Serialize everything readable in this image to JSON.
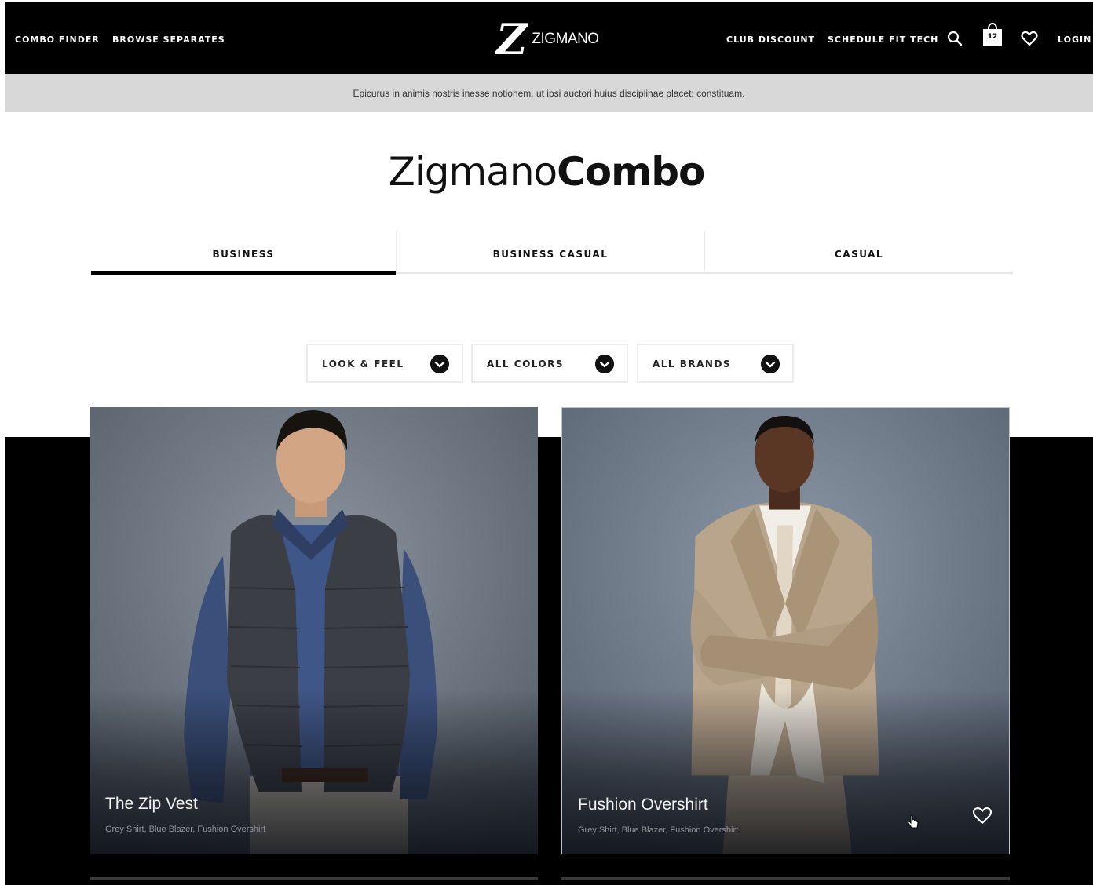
{
  "header": {
    "nav_left": [
      "COMBO FINDER",
      "BROWSE SEPARATES"
    ],
    "logo_mark": "Z",
    "logo_text": "ZIGMANO",
    "nav_right": [
      "CLUB DISCOUNT",
      "SCHEDULE FIT TECH"
    ],
    "bag_count": "12",
    "login": "LOGIN",
    "icons": [
      "search-icon",
      "shopping-bag-icon",
      "heart-icon"
    ]
  },
  "announcement": "Epicurus in animis nostris inesse notionem, ut ipsi auctori huius disciplinae placet: constituam.",
  "title": {
    "light": "Zigmano",
    "bold": "Combo"
  },
  "tabs": [
    {
      "label": "BUSINESS",
      "active": true
    },
    {
      "label": "BUSINESS CASUAL",
      "active": false
    },
    {
      "label": "CASUAL",
      "active": false
    }
  ],
  "filters": [
    {
      "label": "LOOK & FEEL"
    },
    {
      "label": "ALL COLORS"
    },
    {
      "label": "ALL BRANDS"
    }
  ],
  "products": [
    {
      "name": "The Zip Vest",
      "description": "Grey Shirt, Blue Blazer, Fushion Overshirt"
    },
    {
      "name": "Fushion Overshirt",
      "description": "Grey Shirt, Blue Blazer, Fushion Overshirt"
    }
  ],
  "colors": {
    "header_bg": "#000000",
    "announcement_bg": "#d8d8d8",
    "photo_backdrop": "#6b7684"
  }
}
